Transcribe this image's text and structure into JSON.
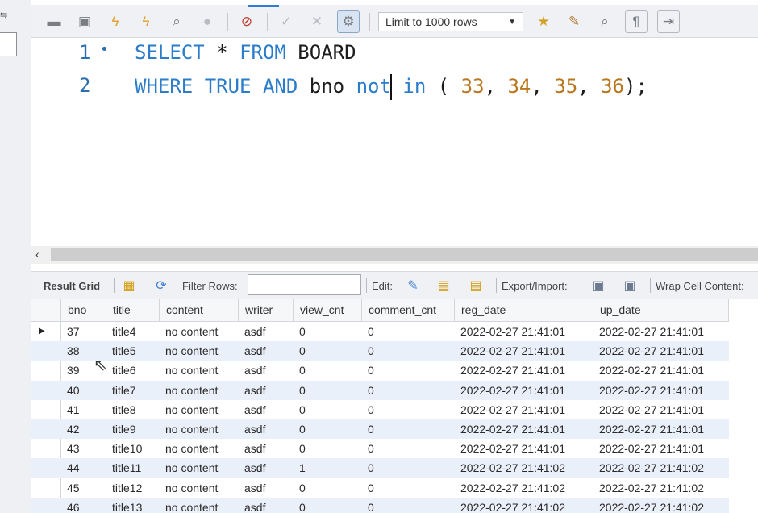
{
  "toolbar": {
    "limit_label": "Limit to 1000 rows"
  },
  "editor": {
    "lines": [
      {
        "number": "1",
        "marker": "•"
      },
      {
        "number": "2",
        "marker": ""
      }
    ],
    "line1": {
      "kw1": "SELECT",
      "rest1": " * ",
      "kw2": "FROM",
      "rest2": " BOARD"
    },
    "line2": {
      "kw1": "WHERE",
      "sp1": " ",
      "kw2": "TRUE",
      "sp2": " ",
      "kw3": "AND",
      "ident": " bno ",
      "kw4a": "not",
      "kw4b": " in",
      "open": " ( ",
      "n1": "33",
      "c1": ", ",
      "n2": "34",
      "c2": ", ",
      "n3": "35",
      "c3": ", ",
      "n4": "36",
      "close": ");"
    }
  },
  "result_toolbar": {
    "result_grid": "Result Grid",
    "filter_rows": "Filter Rows:",
    "filter_value": "",
    "edit": "Edit:",
    "export_import": "Export/Import:",
    "wrap_cell": "Wrap Cell Content:"
  },
  "grid": {
    "columns": [
      "bno",
      "title",
      "content",
      "writer",
      "view_cnt",
      "comment_cnt",
      "reg_date",
      "up_date"
    ],
    "rows": [
      [
        "37",
        "title4",
        "no content",
        "asdf",
        "0",
        "0",
        "2022-02-27 21:41:01",
        "2022-02-27 21:41:01"
      ],
      [
        "38",
        "title5",
        "no content",
        "asdf",
        "0",
        "0",
        "2022-02-27 21:41:01",
        "2022-02-27 21:41:01"
      ],
      [
        "39",
        "title6",
        "no content",
        "asdf",
        "0",
        "0",
        "2022-02-27 21:41:01",
        "2022-02-27 21:41:01"
      ],
      [
        "40",
        "title7",
        "no content",
        "asdf",
        "0",
        "0",
        "2022-02-27 21:41:01",
        "2022-02-27 21:41:01"
      ],
      [
        "41",
        "title8",
        "no content",
        "asdf",
        "0",
        "0",
        "2022-02-27 21:41:01",
        "2022-02-27 21:41:01"
      ],
      [
        "42",
        "title9",
        "no content",
        "asdf",
        "0",
        "0",
        "2022-02-27 21:41:01",
        "2022-02-27 21:41:01"
      ],
      [
        "43",
        "title10",
        "no content",
        "asdf",
        "0",
        "0",
        "2022-02-27 21:41:01",
        "2022-02-27 21:41:01"
      ],
      [
        "44",
        "title11",
        "no content",
        "asdf",
        "1",
        "0",
        "2022-02-27 21:41:02",
        "2022-02-27 21:41:02"
      ],
      [
        "45",
        "title12",
        "no content",
        "asdf",
        "0",
        "0",
        "2022-02-27 21:41:02",
        "2022-02-27 21:41:02"
      ],
      [
        "46",
        "title13",
        "no content",
        "asdf",
        "0",
        "0",
        "2022-02-27 21:41:02",
        "2022-02-27 21:41:02"
      ]
    ]
  },
  "colors": {
    "keyword": "#2b7cc9",
    "number": "#b8761d",
    "row_alt": "#eaf0fa"
  }
}
